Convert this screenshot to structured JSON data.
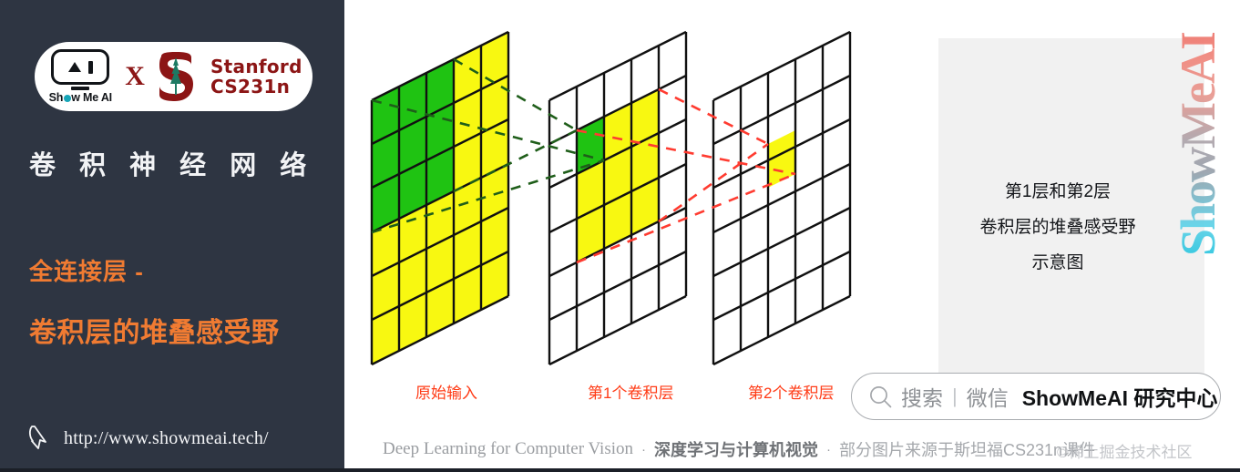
{
  "sidebar": {
    "logo": {
      "showmeai_word": "Show Me AI",
      "robot_icon": "robot-face-icon",
      "cross_label": "X",
      "stanford_tree_icon": "stanford-tree-icon",
      "stanford_line1": "Stanford",
      "stanford_line2": "CS231n"
    },
    "title": "卷 积 神 经 网 络",
    "subtitle_line1": "全连接层 -",
    "subtitle_line2": "卷积层的堆叠感受野",
    "cursor_icon": "mouse-cursor-icon",
    "url": "http://www.showmeai.tech/",
    "bg_color": "#2e3542",
    "accent_color": "#f07b32"
  },
  "diagram": {
    "labels": [
      "原始输入",
      "第1个卷积层",
      "第2个卷积层"
    ],
    "label_color": "#ff3b16",
    "green": "#1fc312",
    "yellow": "#f8f811",
    "stroke": "#111111",
    "green_dash": "#1f5e1a",
    "red_dash": "#ff3b30",
    "layers": [
      {
        "name": "原始输入",
        "cols": 5,
        "rows": 6,
        "green_cells": "3x3 top-left block",
        "yellow_cells": "remaining"
      },
      {
        "name": "第1个卷积层",
        "cols": 5,
        "rows": 6,
        "green_cells": "1 cell",
        "yellow_cells": "3x3 block"
      },
      {
        "name": "第2个卷积层",
        "cols": 5,
        "rows": 6,
        "green_cells": "0",
        "yellow_cells": "1 cell"
      }
    ]
  },
  "note": {
    "line1": "第1层和第2层",
    "line2": "卷积层的堆叠感受野",
    "line3": "示意图",
    "panel_color": "#f1f1f1",
    "brand_vertical": "ShowMeAI"
  },
  "search": {
    "magnifier_icon": "search-icon",
    "placeholder": "搜索",
    "divider": "|",
    "source": "微信",
    "brand": "ShowMeAI 研究中心"
  },
  "footer": {
    "english": "Deep Learning for Computer Vision",
    "dot": "·",
    "chinese": "深度学习与计算机视觉",
    "tail": "部分图片来源于斯坦福CS231n课件",
    "watermark": "©稀土掘金技术社区"
  }
}
